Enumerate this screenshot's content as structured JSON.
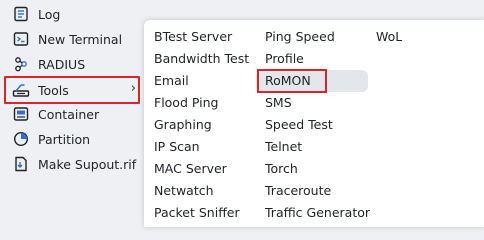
{
  "sidebar": {
    "items": [
      {
        "label": "Log",
        "icon": "log-icon"
      },
      {
        "label": "New Terminal",
        "icon": "terminal-icon"
      },
      {
        "label": "RADIUS",
        "icon": "radius-icon"
      },
      {
        "label": "Tools",
        "icon": "tools-icon",
        "chevron": "›"
      },
      {
        "label": "Container",
        "icon": "container-icon"
      },
      {
        "label": "Partition",
        "icon": "partition-icon"
      },
      {
        "label": "Make Supout.rif",
        "icon": "file-icon"
      }
    ]
  },
  "submenu": {
    "col1": [
      "BTest Server",
      "Bandwidth Test",
      "Email",
      "Flood Ping",
      "Graphing",
      "IP Scan",
      "MAC Server",
      "Netwatch",
      "Packet Sniffer"
    ],
    "col2": [
      "Ping Speed",
      "Profile",
      "RoMON",
      "SMS",
      "Speed Test",
      "Telnet",
      "Torch",
      "Traceroute",
      "Traffic Generator"
    ],
    "col3": [
      "WoL"
    ]
  },
  "colors": {
    "highlight": "#d8262e",
    "icon_blue": "#2b6fd6",
    "sidebar_bg": "#eef0f3"
  }
}
